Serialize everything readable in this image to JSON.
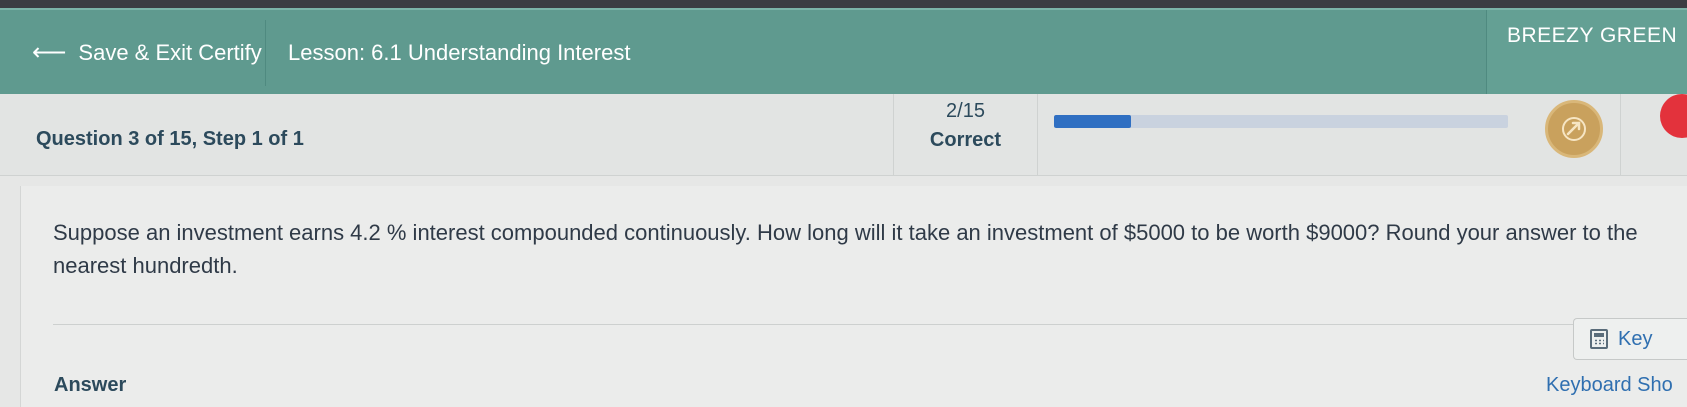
{
  "header": {
    "back_label": "Save & Exit Certify",
    "lesson_title": "Lesson: 6.1 Understanding Interest",
    "user_name": "BREEZY GREEN"
  },
  "status": {
    "question_label": "Question 3 of 15, Step 1 of 1",
    "score": "2/15",
    "score_label": "Correct",
    "progress_fraction": 0.17
  },
  "question": {
    "text": "Suppose an investment earns 4.2 %  interest compounded continuously. How long will it take an investment of $5000 to be worth $9000? Round your answer to the nearest hundredth."
  },
  "answer": {
    "label": "Answer",
    "keypad_label": "Key",
    "shortcuts_label": "Keyboard Sho"
  },
  "colors": {
    "header_bg": "#5f9a8f",
    "progress_fill": "#2f6fc2",
    "accent_text": "#2c4a5c",
    "link": "#2f6fb0"
  },
  "icons": {
    "back": "left-arrow-icon",
    "badge": "rocket-badge-icon",
    "keypad": "calculator-icon"
  }
}
